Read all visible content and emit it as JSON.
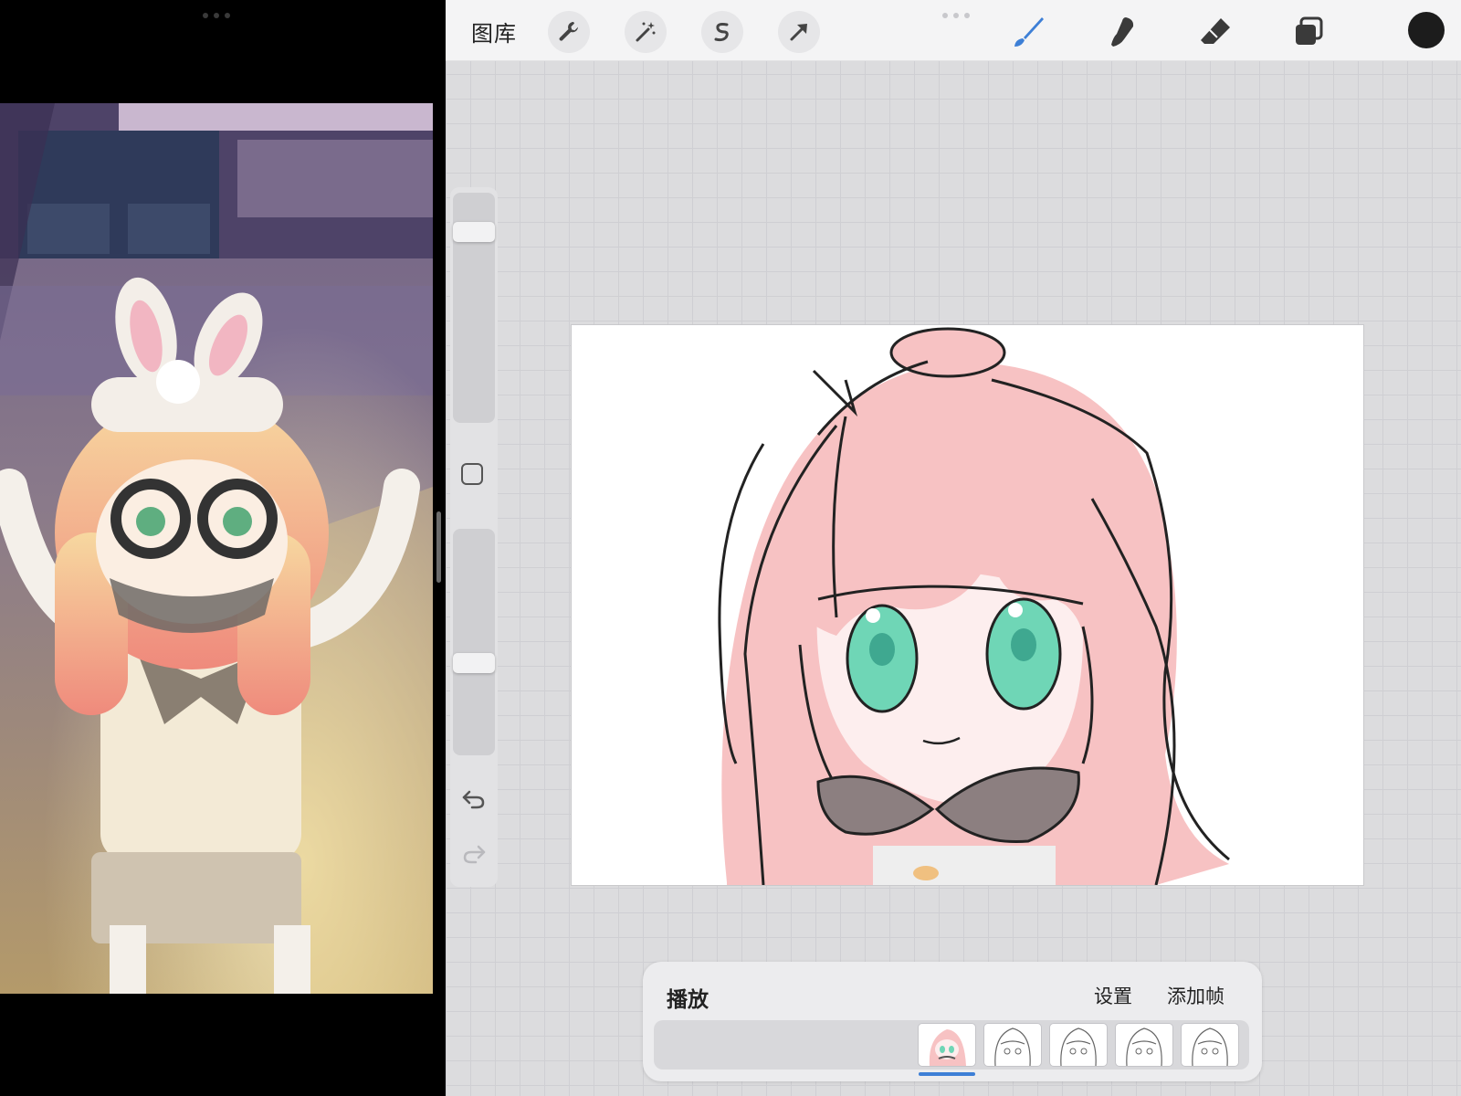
{
  "toolbar": {
    "gallery_label": "图库",
    "tools": [
      {
        "name": "actions-wrench",
        "icon": "wrench-icon"
      },
      {
        "name": "adjustments-magic-wand",
        "icon": "magic-wand-icon"
      },
      {
        "name": "selection",
        "icon": "selection-s-icon"
      },
      {
        "name": "transform",
        "icon": "arrow-cursor-icon"
      }
    ],
    "right_tools": [
      {
        "name": "brush",
        "icon": "brush-icon",
        "active": true
      },
      {
        "name": "smudge",
        "icon": "smudge-finger-icon",
        "active": false
      },
      {
        "name": "eraser",
        "icon": "eraser-icon",
        "active": false
      },
      {
        "name": "layers",
        "icon": "layers-icon",
        "active": false
      }
    ],
    "current_color": "#1c1c1c"
  },
  "sidebar": {
    "brush_size_level": 0.86,
    "opacity_level": 0.4,
    "modify_icon": "square-icon",
    "undo_icon": "undo-icon",
    "redo_icon": "redo-icon"
  },
  "animation_panel": {
    "playback_label": "播放",
    "settings_label": "设置",
    "add_frame_label": "添加帧",
    "frames": [
      {
        "name": "frame-1",
        "colored": true,
        "selected": true
      },
      {
        "name": "frame-2",
        "colored": false,
        "selected": false
      },
      {
        "name": "frame-3",
        "colored": false,
        "selected": false
      },
      {
        "name": "frame-4",
        "colored": false,
        "selected": false
      },
      {
        "name": "frame-5",
        "colored": false,
        "selected": false
      }
    ]
  },
  "colors": {
    "accent": "#3d7fd6",
    "hair": "#f7c2c3",
    "eyes": "#6fd6b6",
    "skin": "#fdeeee",
    "glasses": "#8c7f80"
  }
}
